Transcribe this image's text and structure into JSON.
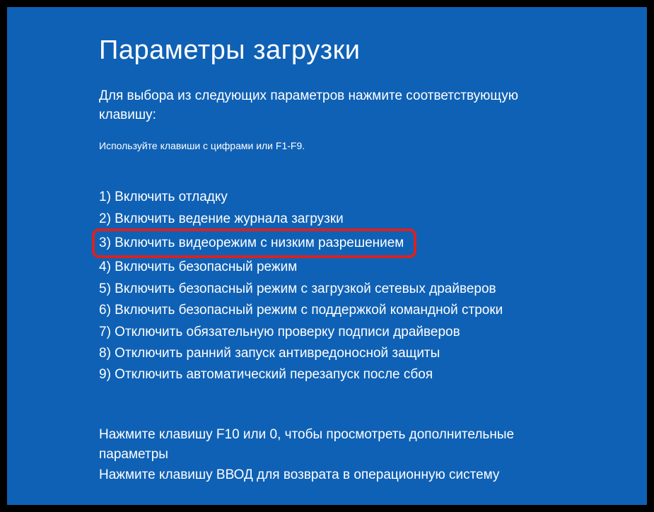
{
  "title": "Параметры загрузки",
  "instruction": "Для выбора из следующих параметров нажмите соответствующую клавишу:",
  "hint": "Используйте клавиши с цифрами или F1-F9.",
  "options": [
    {
      "num": "1",
      "label": "1) Включить отладку"
    },
    {
      "num": "2",
      "label": "2) Включить ведение журнала загрузки"
    },
    {
      "num": "3",
      "label": "3) Включить видеорежим с низким разрешением"
    },
    {
      "num": "4",
      "label": "4) Включить безопасный режим"
    },
    {
      "num": "5",
      "label": "5) Включить безопасный режим с загрузкой сетевых драйверов"
    },
    {
      "num": "6",
      "label": "6) Включить безопасный режим с поддержкой командной строки"
    },
    {
      "num": "7",
      "label": "7) Отключить обязательную проверку подписи драйверов"
    },
    {
      "num": "8",
      "label": "8) Отключить ранний запуск антивредоносной защиты"
    },
    {
      "num": "9",
      "label": "9) Отключить автоматический перезапуск после сбоя"
    }
  ],
  "footer1": "Нажмите клавишу F10 или 0, чтобы просмотреть дополнительные параметры",
  "footer2": "Нажмите клавишу ВВОД для возврата в операционную систему",
  "highlighted_index": 2
}
